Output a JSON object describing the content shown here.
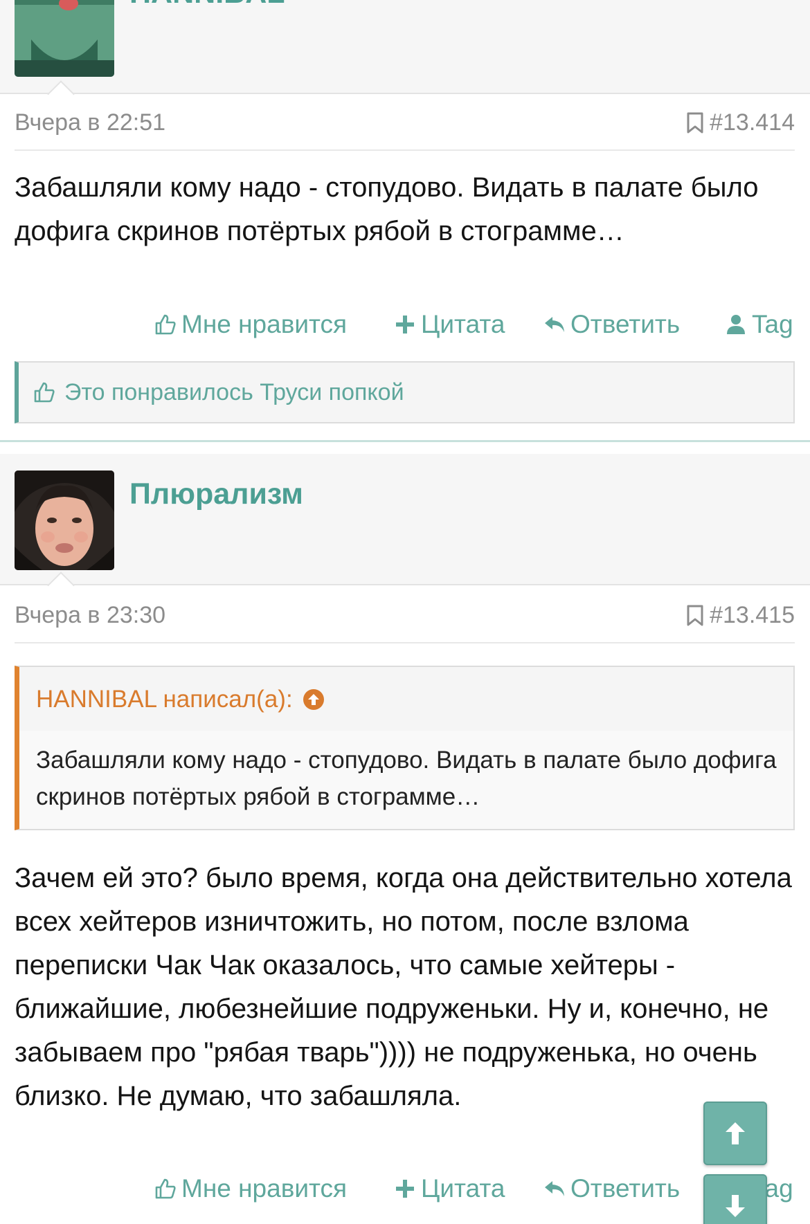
{
  "post1": {
    "username": "HANNIBAL",
    "date": "Вчера в 22:51",
    "number": "#13.414",
    "text": "Забашляли кому надо - стопудово. Видать в палате было дофига скринов потёртых рябой в стограмме…",
    "actions": {
      "like": "Мне нравится",
      "quote": "Цитата",
      "reply": "Ответить",
      "tag": "Tag"
    },
    "likes_text": "Это понравилось Труси попкой"
  },
  "post2": {
    "username": "Плюрализм",
    "date": "Вчера в 23:30",
    "number": "#13.415",
    "quote": {
      "author": "HANNIBAL написал(а):",
      "text": "Забашляли кому надо - стопудово. Видать в палате было дофига скринов потёртых рябой в стограмме…"
    },
    "text": "Зачем ей это? было время, когда она действительно хотела всех хейтеров изничтожить, но потом, после взлома переписки Чак Чак оказалось, что самые хейтеры - ближайшие, любезнейшие подруженьки. Ну и, конечно, не забываем про \"рябая тварь\")))) не подруженька, но очень близко. Не думаю, что забашляла.",
    "actions": {
      "like": "Мне нравится",
      "quote": "Цитата",
      "reply": "Ответить",
      "tag": "Tag"
    }
  },
  "colors": {
    "accent": "#5ea49a",
    "quote_accent": "#e0832f"
  }
}
